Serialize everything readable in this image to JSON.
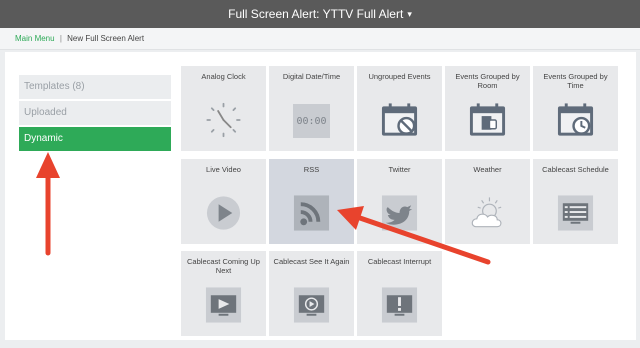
{
  "header": {
    "title": "Full Screen Alert: YTTV Full Alert",
    "caret": "▾"
  },
  "breadcrumb": {
    "home": "Main Menu",
    "separator": "|",
    "current": "New Full Screen Alert"
  },
  "sidebar": {
    "items": [
      {
        "label": "Templates (8)"
      },
      {
        "label": "Uploaded"
      },
      {
        "label": "Dynamic",
        "active": true
      }
    ]
  },
  "tiles": [
    {
      "label": "Analog Clock",
      "icon": "analog-clock-icon"
    },
    {
      "label": "Digital Date/Time",
      "icon": "digital-clock-icon",
      "digits": "00:00"
    },
    {
      "label": "Ungrouped Events",
      "icon": "calendar-prohibited-icon"
    },
    {
      "label": "Events Grouped by Room",
      "icon": "calendar-room-icon"
    },
    {
      "label": "Events Grouped by Time",
      "icon": "calendar-time-icon"
    },
    {
      "label": "Live Video",
      "icon": "play-icon"
    },
    {
      "label": "RSS",
      "icon": "rss-icon",
      "selected": true
    },
    {
      "label": "Twitter",
      "icon": "twitter-bird-icon"
    },
    {
      "label": "Weather",
      "icon": "weather-icon"
    },
    {
      "label": "Cablecast Schedule",
      "icon": "schedule-list-icon"
    },
    {
      "label": "Cablecast Coming Up Next",
      "icon": "tv-next-icon"
    },
    {
      "label": "Cablecast See It Again",
      "icon": "tv-replay-icon"
    },
    {
      "label": "Cablecast Interrupt",
      "icon": "alert-icon"
    }
  ],
  "colors": {
    "accent": "#2eaa58",
    "annotation": "#e8432d",
    "topbar": "#5a5a5a"
  }
}
